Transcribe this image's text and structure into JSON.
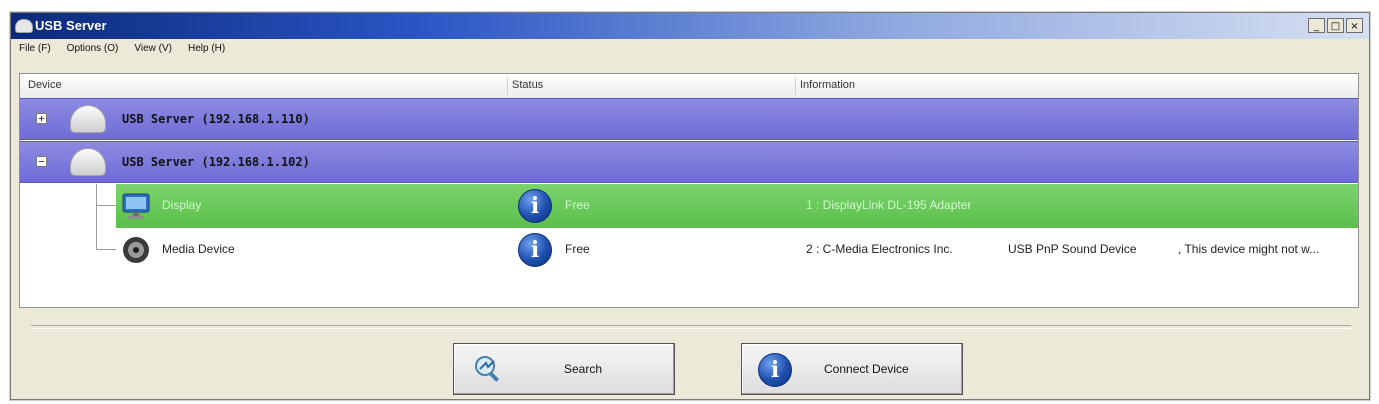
{
  "window": {
    "title": "USB Server",
    "controls": {
      "minimize": "_",
      "maximize": "□",
      "close": "×"
    }
  },
  "menu": {
    "items": [
      {
        "label": "File (F)"
      },
      {
        "label": "Options (O)"
      },
      {
        "label": "View (V)"
      },
      {
        "label": "Help (H)"
      }
    ]
  },
  "tree": {
    "columns": {
      "device": "Device",
      "status": "Status",
      "information": "Information"
    },
    "servers": [
      {
        "label": "USB Server  (192.168.1.110)",
        "toggle": "+"
      },
      {
        "label": "USB Server  (192.168.1.102)",
        "toggle": "−"
      }
    ],
    "devices": [
      {
        "name": "Display",
        "status": "Free",
        "info": [
          "1 : DisplayLink DL-195 Adapter"
        ],
        "selected": true,
        "icon": "monitor-icon"
      },
      {
        "name": "Media Device",
        "status": "Free",
        "info": [
          "2 : C-Media Electronics Inc.",
          "USB PnP Sound Device",
          ", This device might not w..."
        ],
        "selected": false,
        "icon": "speaker-icon"
      }
    ]
  },
  "buttons": {
    "search": "Search",
    "connect": "Connect Device"
  },
  "colors": {
    "server_row": "#7572d9",
    "selected_row": "#64c456",
    "info_icon": "#1f4fae"
  }
}
